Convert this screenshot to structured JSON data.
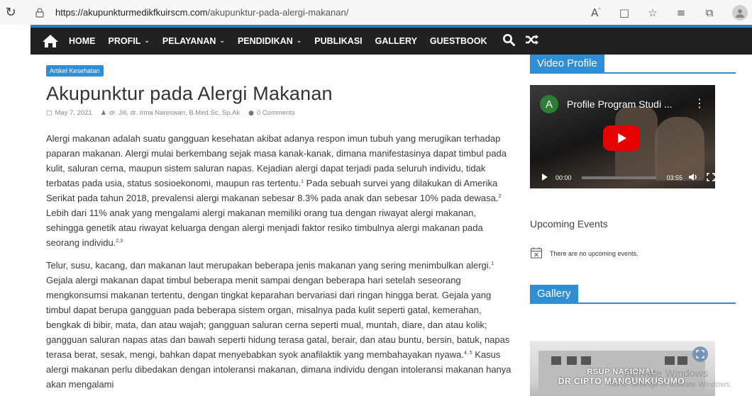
{
  "browser": {
    "url_host": "https://akupunkturmedikfkuirscm.com",
    "url_path": "/akupunktur-pada-alergi-makanan/",
    "reload_icon": "reload-icon",
    "icons": [
      "read-aloud-icon",
      "reader-view-icon",
      "favorite-add-icon",
      "favorites-icon",
      "collections-icon",
      "profile-avatar-icon"
    ]
  },
  "nav": {
    "items": [
      {
        "label": "HOME",
        "dropdown": false
      },
      {
        "label": "PROFIL",
        "dropdown": true
      },
      {
        "label": "PELAYANAN",
        "dropdown": true
      },
      {
        "label": "PENDIDIKAN",
        "dropdown": true
      },
      {
        "label": "PUBLIKASI",
        "dropdown": false
      },
      {
        "label": "GALLERY",
        "dropdown": false
      },
      {
        "label": "GUESTBOOK",
        "dropdown": false
      }
    ],
    "bar_color": "#212121",
    "accent_color": "#2f7ab7"
  },
  "article": {
    "category": "Artikel Kesehatan",
    "title": "Akupunktur pada Alergi Makanan",
    "date": "May 7, 2021",
    "author": "dr. Jill, dr. Irma Nareswari, B.Med.Sc, Sp.Ak",
    "comments": "0 Comments",
    "p1": {
      "t1": "Alergi makanan adalah suatu gangguan kesehatan akibat adanya respon imun tubuh yang merugikan terhadap paparan makanan. Alergi mulai berkembang sejak masa kanak-kanak, dimana manifestasinya dapat timbul pada kulit, saluran cerna, maupun sistem saluran napas. Kejadian alergi dapat terjadi pada seluruh individu, tidak terbatas pada usia, status sosioekonomi, maupun ras tertentu.",
      "s1": "1",
      "t2": " Pada sebuah survei yang dilakukan di Amerika Serikat pada tahun 2018, prevalensi alergi makanan sebesar 8.3% pada anak dan sebesar 10% pada dewasa.",
      "s2": "2",
      "t3": " Lebih dari 11% anak yang mengalami alergi makanan memiliki orang tua dengan riwayat alergi makanan, sehingga genetik atau riwayat keluarga dengan alergi menjadi faktor resiko timbulnya alergi makanan pada seorang individu.",
      "s3": "2,3"
    },
    "p2": {
      "t1": "Telur, susu, kacang, dan makanan laut merupakan beberapa jenis makanan yang sering menimbulkan alergi.",
      "s1": "1",
      "t2": " Gejala alergi makanan dapat timbul beberapa menit sampai dengan beberapa hari setelah seseorang mengkonsumsi makanan tertentu, dengan tingkat keparahan bervariasi dari ringan hingga berat. Gejala yang timbul dapat berupa gangguan pada beberapa sistem organ, misalnya pada kulit seperti gatal, kemerahan, bengkak di bibir, mata, dan atau wajah; gangguan saluran cerna seperti mual, muntah, diare, dan atau kolik; gangguan saluran napas atas dan bawah seperti hidung terasa gatal, berair, dan atau buntu, bersin, batuk, napas terasa berat, sesak, mengi, bahkan dapat menyebabkan syok anafilaktik yang membahayakan nyawa.",
      "s2": "4, 5",
      "t3": " Kasus alergi makanan perlu dibedakan dengan intoleransi makanan, dimana individu dengan intoleransi makanan hanya akan mengalami"
    }
  },
  "sidebar": {
    "video_title": "Video Profile",
    "video": {
      "channel_letter": "A",
      "title": "Profile Program Studi ...",
      "current_time": "00:00",
      "duration": "03:55"
    },
    "upcoming_title": "Upcoming Events",
    "no_events": "There are no upcoming events.",
    "gallery_title": "Gallery",
    "gallery_sign_line1": "RSUP NASIONAL",
    "gallery_sign_line2": "DR CIPTO MANGUNKUSUMO",
    "accent_color": "#2f8ed4"
  },
  "watermark": {
    "line1": "Activate Windows",
    "line2": "Go to Settings to activate Windows."
  }
}
